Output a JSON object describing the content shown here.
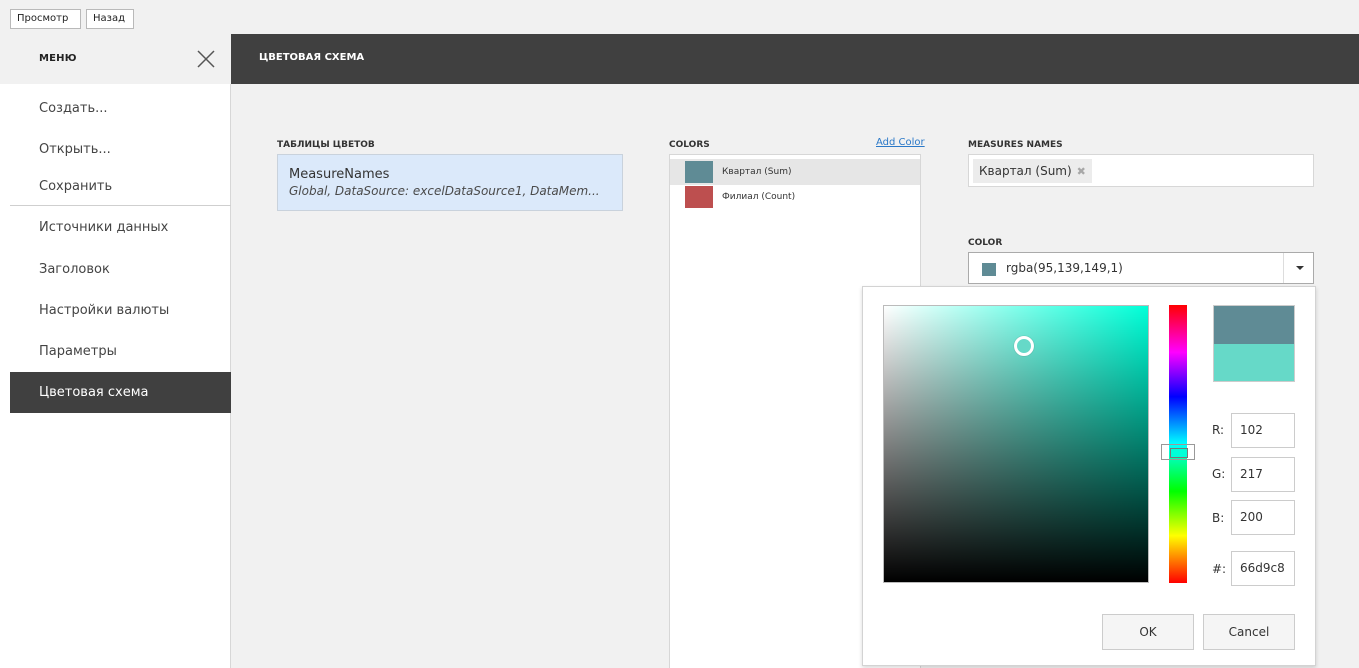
{
  "toolbar": {
    "preview_label": "Просмотр",
    "back_label": "Назад"
  },
  "menu": {
    "title": "МЕНЮ",
    "items": [
      {
        "label": "Создать..."
      },
      {
        "label": "Открыть..."
      },
      {
        "label": "Сохранить"
      },
      {
        "label": "Источники данных"
      },
      {
        "label": "Заголовок"
      },
      {
        "label": "Настройки валюты"
      },
      {
        "label": "Параметры"
      },
      {
        "label": "Цветовая схема"
      }
    ],
    "active_item": "Цветовая схема"
  },
  "header": {
    "title": "ЦВЕТОВАЯ СХЕМА"
  },
  "color_tables": {
    "label": "ТАБЛИЦЫ ЦВЕТОВ",
    "items": [
      {
        "name": "MeasureNames",
        "description": "Global, DataSource: excelDataSource1, DataMem..."
      }
    ]
  },
  "colors": {
    "label": "COLORS",
    "add_label": "Add Color",
    "items": [
      {
        "label": "Квартал (Sum)",
        "color": "#5f8b95",
        "selected": true
      },
      {
        "label": "Филиал (Count)",
        "color": "#bd4f4f",
        "selected": false
      }
    ]
  },
  "measures_names": {
    "label": "MEASURES NAMES",
    "tags": [
      {
        "label": "Квартал (Sum)",
        "remove": "✖"
      }
    ]
  },
  "color_field": {
    "label": "COLOR",
    "value": "rgba(95,139,149,1)",
    "swatch": "#5f8b95"
  },
  "picker": {
    "old_color": "#5f8b95",
    "new_color": "#66d9c8",
    "hue_color": "#00ffd8",
    "r_label": "R:",
    "r": "102",
    "g_label": "G:",
    "g": "217",
    "b_label": "B:",
    "b": "200",
    "hex_label": "#:",
    "hex": "66d9c8",
    "ok_label": "OK",
    "cancel_label": "Cancel"
  }
}
